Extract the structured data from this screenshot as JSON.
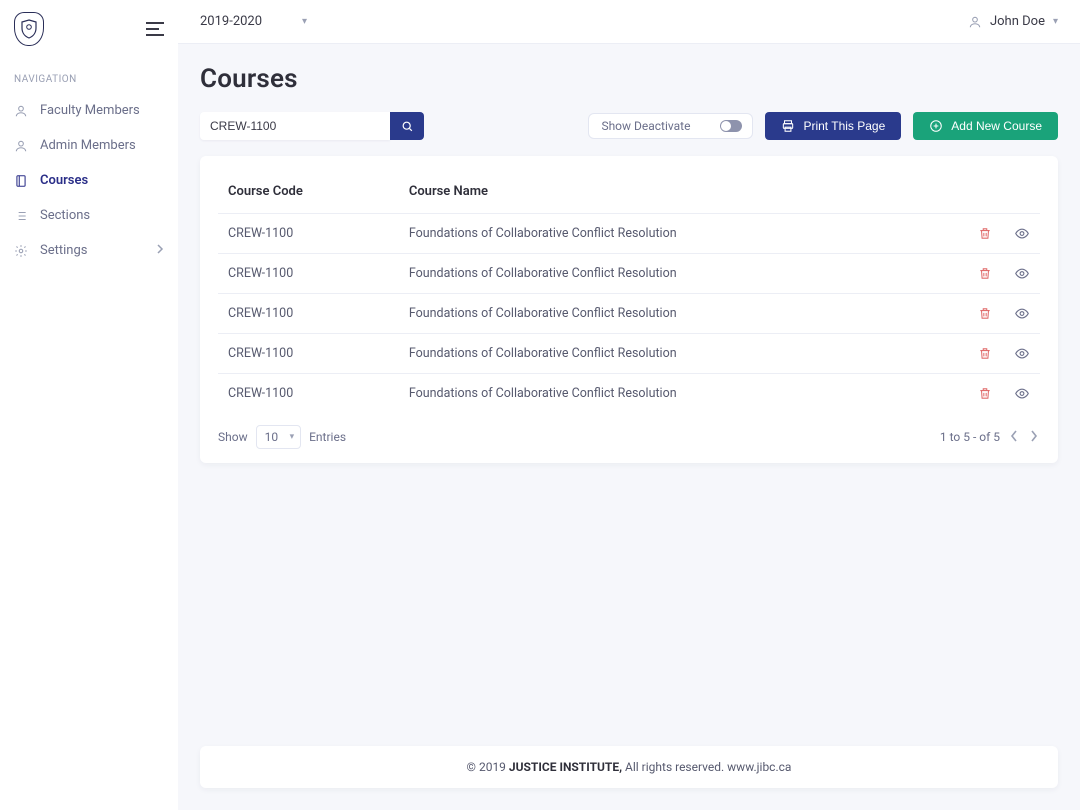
{
  "sidebar": {
    "nav_heading": "NAVIGATION",
    "items": [
      {
        "label": "Faculty Members",
        "active": false
      },
      {
        "label": "Admin Members",
        "active": false
      },
      {
        "label": "Courses",
        "active": true
      },
      {
        "label": "Sections",
        "active": false
      },
      {
        "label": "Settings",
        "active": false,
        "has_children": true
      }
    ]
  },
  "topbar": {
    "year": "2019-2020",
    "user_name": "John Doe"
  },
  "page": {
    "title": "Courses"
  },
  "toolbar": {
    "search_value": "CREW-1100",
    "show_deactivate_label": "Show Deactivate",
    "print_label": "Print This Page",
    "add_label": "Add New Course"
  },
  "table": {
    "headers": {
      "code": "Course Code",
      "name": "Course Name"
    },
    "rows": [
      {
        "code": "CREW-1100",
        "name": "Foundations of Collaborative Conflict Resolution"
      },
      {
        "code": "CREW-1100",
        "name": "Foundations of Collaborative Conflict Resolution"
      },
      {
        "code": "CREW-1100",
        "name": "Foundations of Collaborative Conflict Resolution"
      },
      {
        "code": "CREW-1100",
        "name": "Foundations of Collaborative Conflict Resolution"
      },
      {
        "code": "CREW-1100",
        "name": "Foundations of Collaborative Conflict Resolution"
      }
    ],
    "footer": {
      "show_label": "Show",
      "page_size": "10",
      "entries_label": "Entries",
      "range": "1 to 5 - of  5"
    }
  },
  "footer": {
    "copyright_prefix": "© 2019 ",
    "brand": "JUSTICE INSTITUTE,",
    "rest": "  All rights reserved. www.jibc.ca"
  }
}
